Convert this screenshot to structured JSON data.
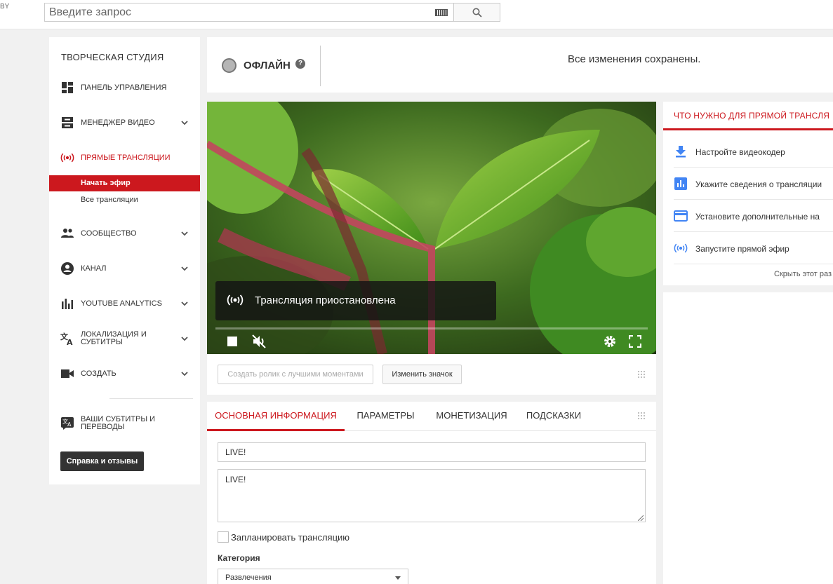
{
  "topbar": {
    "region": "BY",
    "search_placeholder": "Введите запрос"
  },
  "sidebar": {
    "studio_title": "ТВОРЧЕСКАЯ СТУДИЯ",
    "items": [
      {
        "label": "ПАНЕЛЬ УПРАВЛЕНИЯ",
        "icon": "dashboard-icon"
      },
      {
        "label": "МЕНЕДЖЕР ВИДЕО",
        "icon": "video-manager-icon"
      },
      {
        "label": "ПРЯМЫЕ ТРАНСЛЯЦИИ",
        "icon": "live-broadcast-icon"
      },
      {
        "label": "СООБЩЕСТВО",
        "icon": "community-icon"
      },
      {
        "label": "КАНАЛ",
        "icon": "channel-icon"
      },
      {
        "label": "YOUTUBE ANALYTICS",
        "icon": "analytics-icon"
      },
      {
        "label": "ЛОКАЛИЗАЦИЯ И СУБТИТРЫ",
        "icon": "translate-icon"
      },
      {
        "label": "СОЗДАТЬ",
        "icon": "camera-icon"
      }
    ],
    "live_sub": [
      {
        "label": "Начать эфир",
        "active": true
      },
      {
        "label": "Все трансляции",
        "active": false
      }
    ],
    "subtitles_label": "ВАШИ СУБТИТРЫ И ПЕРЕВОДЫ",
    "help_button": "Справка и отзывы"
  },
  "status": {
    "label": "ОФЛАЙН",
    "help_glyph": "?",
    "saved_message": "Все изменения сохранены."
  },
  "video": {
    "overlay_message": "Трансляция приостановлена",
    "highlights_button": "Создать ролик с лучшими моментами",
    "change_icon_button": "Изменить значок"
  },
  "tabs": {
    "items": [
      {
        "label": "ОСНОВНАЯ ИНФОРМАЦИЯ",
        "active": true
      },
      {
        "label": "ПАРАМЕТРЫ",
        "active": false
      },
      {
        "label": "МОНЕТИЗАЦИЯ",
        "active": false
      },
      {
        "label": "ПОДСКАЗКИ",
        "active": false
      }
    ],
    "title_value": "LIVE!",
    "description_value": "LIVE!",
    "schedule_label": "Запланировать трансляцию",
    "category_label": "Категория",
    "category_value": "Развлечения"
  },
  "right_panel": {
    "title": "ЧТО НУЖНО ДЛЯ ПРЯМОЙ ТРАНСЛЯ",
    "items": [
      {
        "label": "Настройте видеокодер",
        "icon": "download-icon"
      },
      {
        "label": "Укажите сведения о трансляции",
        "icon": "bar-chart-icon"
      },
      {
        "label": "Установите дополнительные на",
        "icon": "card-icon"
      },
      {
        "label": "Запустите прямой эфир",
        "icon": "live-broadcast-icon"
      }
    ],
    "hide_link": "Скрыть этот раз"
  },
  "colors": {
    "accent": "#cc181e",
    "blue_icon": "#4285f4"
  }
}
